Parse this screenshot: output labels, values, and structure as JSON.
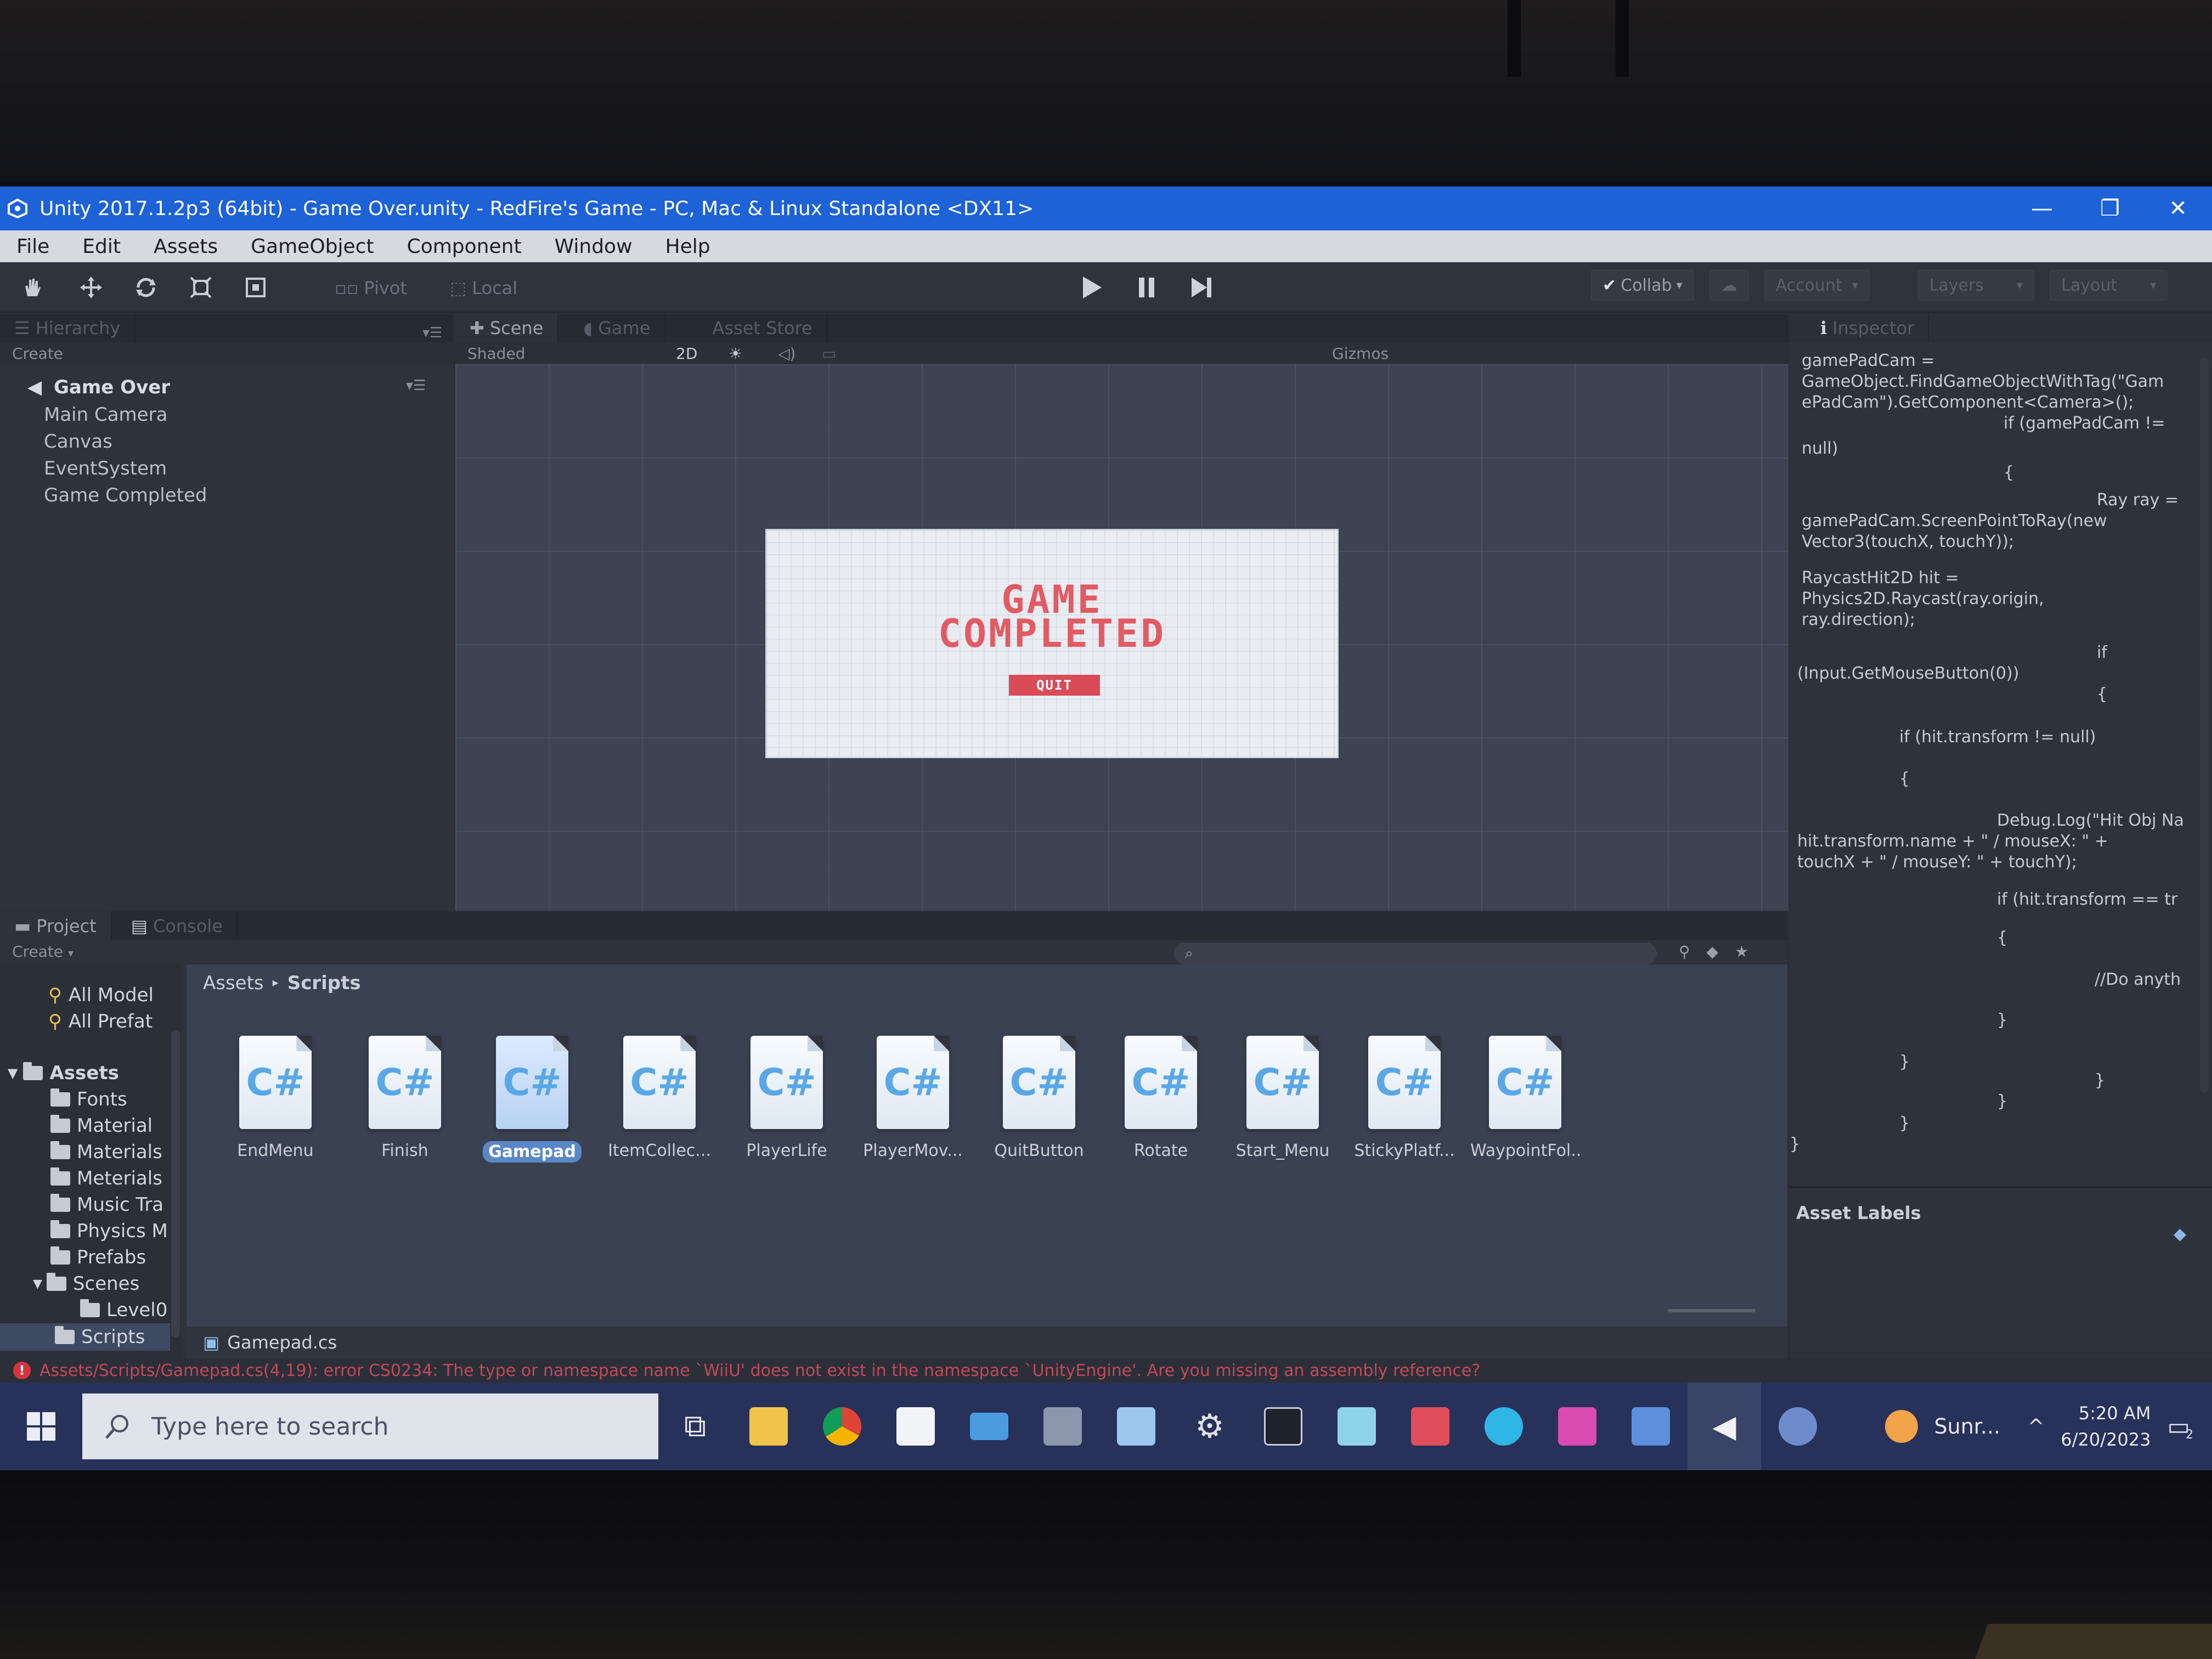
{
  "window": {
    "title": "Unity 2017.1.2p3 (64bit) - Game Over.unity - RedFire's Game - PC, Mac & Linux Standalone <DX11>",
    "controls": [
      "—",
      "❐",
      "✕"
    ]
  },
  "menu": [
    "File",
    "Edit",
    "Assets",
    "GameObject",
    "Component",
    "Window",
    "Help"
  ],
  "toolbar": {
    "pivot": "Pivot",
    "local": "Local",
    "collab": "Collab",
    "account": "Account",
    "layers": "Layers",
    "layout": "Layout"
  },
  "hierarchy": {
    "tab": "Hierarchy",
    "create": "Create",
    "scene": "Game Over",
    "items": [
      "Main Camera",
      "Canvas",
      "EventSystem",
      "Game Completed"
    ]
  },
  "scene": {
    "tabs": [
      "Scene",
      "Game",
      "Asset Store"
    ],
    "shading": "Shaded",
    "mode2d": "2D",
    "gizmos": "Gizmos"
  },
  "game_canvas": {
    "title": "GAME\nCOMPLETED",
    "button": "QUIT"
  },
  "inspector": {
    "tab": "Inspector",
    "code": [
      "gamePadCam =",
      "GameObject.FindGameObjectWithTag(\"Gam",
      "ePadCam\").GetComponent<Camera>();",
      "if (gamePadCam !=",
      "null)",
      "{",
      "Ray ray =",
      "gamePadCam.ScreenPointToRay(new",
      "Vector3(touchX, touchY));",
      "RaycastHit2D hit =",
      "Physics2D.Raycast(ray.origin,",
      "ray.direction);",
      "if",
      "(Input.GetMouseButton(0))",
      "{",
      "if (hit.transform != null)",
      "{",
      "Debug.Log(\"Hit Obj Na",
      "hit.transform.name + \" / mouseX: \" +",
      "touchX + \" / mouseY: \" + touchY);",
      "if (hit.transform == tr",
      "{",
      "//Do anyth",
      "}",
      "}",
      "}",
      "}",
      "}",
      "}"
    ],
    "asset_labels": "Asset Labels"
  },
  "project": {
    "tabs": [
      "Project",
      "Console"
    ],
    "create": "Create",
    "favorites": [
      "All Model",
      "All Prefat"
    ],
    "root": "Assets",
    "folders": [
      "Fonts",
      "Material",
      "Materials",
      "Meterials",
      "Music Tra",
      "Physics M",
      "Prefabs",
      "Scenes",
      "Level0",
      "Scripts"
    ],
    "breadcrumb": [
      "Assets",
      "Scripts"
    ],
    "scripts": [
      "EndMenu",
      "Finish",
      "Gamepad",
      "ItemCollec...",
      "PlayerLife",
      "PlayerMov...",
      "QuitButton",
      "Rotate",
      "Start_Menu",
      "StickyPlatf...",
      "WaypointFol..."
    ],
    "selected_file": "Gamepad.cs",
    "cs_glyph": "C#"
  },
  "error": "Assets/Scripts/Gamepad.cs(4,19): error CS0234: The type or namespace name `WiiU' does not exist in the namespace `UnityEngine'. Are you missing an assembly reference?",
  "taskbar": {
    "search_placeholder": "Type here to search",
    "weather": "Sunr...",
    "time": "5:20 AM",
    "date": "6/20/2023",
    "notif_count": "2"
  }
}
